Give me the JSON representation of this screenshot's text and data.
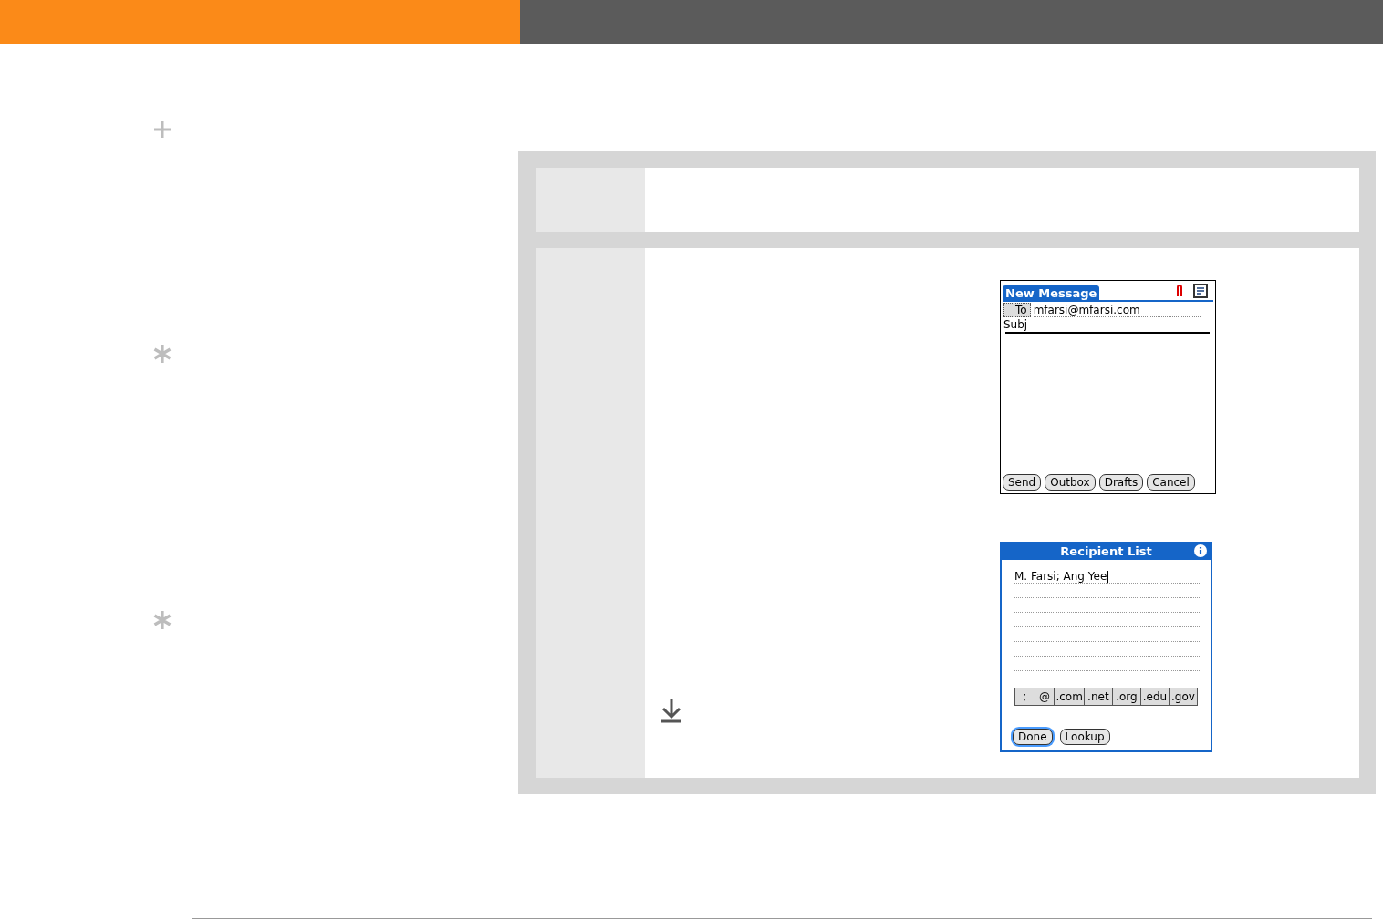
{
  "new_message": {
    "title": "New Message",
    "to_label": "To",
    "to_value": "mfarsi@mfarsi.com",
    "subject_label": "Subj",
    "buttons": [
      "Send",
      "Outbox",
      "Drafts",
      "Cancel"
    ]
  },
  "recipient_list": {
    "title": "Recipient List",
    "value": "M. Farsi; Ang Yee",
    "shortcuts": [
      ";",
      "@",
      ".com",
      ".net",
      ".org",
      ".edu",
      ".gov"
    ],
    "buttons": [
      {
        "label": "Done",
        "selected": true
      },
      {
        "label": "Lookup",
        "selected": false
      }
    ]
  }
}
